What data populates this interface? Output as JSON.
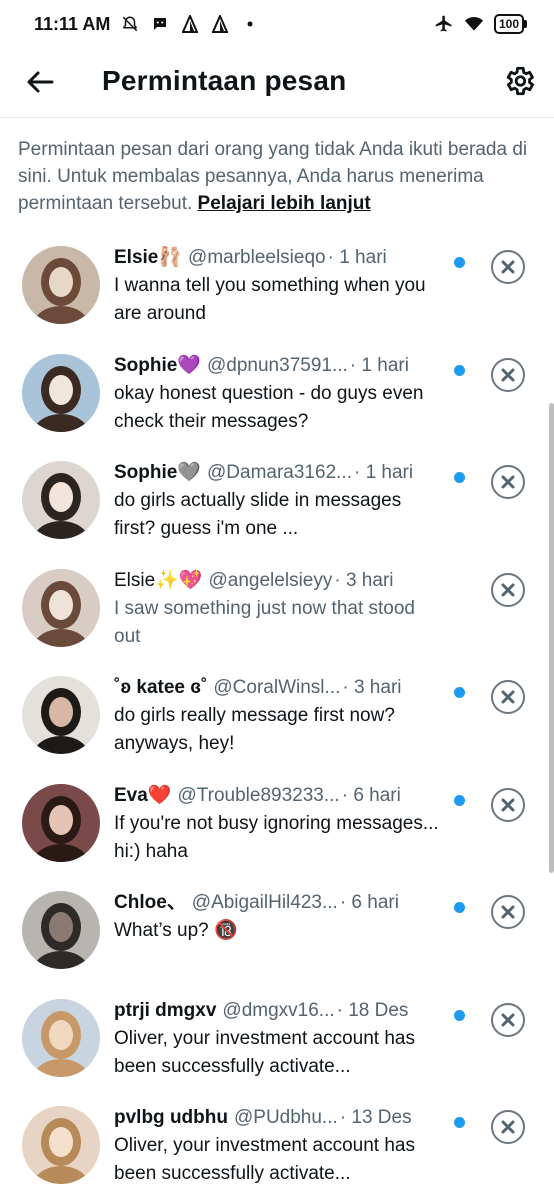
{
  "status_bar": {
    "time": "11:11 AM",
    "battery": "100",
    "icons_left": [
      "notifications-off-icon",
      "chat-bubble-icon",
      "signal-triangle-icon",
      "signal-triangle-icon",
      "dot-icon"
    ],
    "icons_right": [
      "airplane-icon",
      "wifi-icon",
      "battery-icon"
    ]
  },
  "header": {
    "title": "Permintaan pesan",
    "back_icon": "arrow-left-icon",
    "settings_icon": "gear-icon"
  },
  "info": {
    "text": "Permintaan pesan dari orang yang tidak Anda ikuti berada di sini. Untuk membalas pesannya, Anda harus menerima permintaan tersebut. ",
    "link": "Pelajari lebih lanjut"
  },
  "colors": {
    "accent_blue": "#1d9bf0",
    "text_primary": "#0f1419",
    "text_secondary": "#536471"
  },
  "requests": [
    {
      "name": "Elsie🩰",
      "handle": "@marbleelsieqo",
      "time": "· 1 hari",
      "message": "I wanna tell you something when you are around",
      "unread": true
    },
    {
      "name": "Sophie💜",
      "handle": "@dpnun37591...",
      "time": "· 1 hari",
      "message": "okay honest question - do guys even check their messages?",
      "unread": true
    },
    {
      "name": "Sophie🩶",
      "handle": "@Damara3162...",
      "time": "· 1 hari",
      "message": "do girls actually slide in messages first? guess i'm one ...",
      "unread": true
    },
    {
      "name": "Elsie✨💖",
      "handle": "@angelelsieyy",
      "time": "· 3 hari",
      "message": "I saw something just now that stood out",
      "unread": false
    },
    {
      "name": "˚ʚ katee ɞ˚",
      "handle": "@CoralWinsl...",
      "time": "· 3 hari",
      "message": "do girls really message first now? anyways, hey!",
      "unread": true
    },
    {
      "name": "Eva❤️",
      "handle": "@Trouble893233...",
      "time": "· 6 hari",
      "message": "If you're not busy ignoring messages... hi:) haha",
      "unread": true
    },
    {
      "name": "Chloe、",
      "handle": "@AbigailHil423...",
      "time": "· 6 hari",
      "message": "What’s up? 🔞",
      "unread": true
    },
    {
      "name": "ptrji dmgxv",
      "handle": "@dmgxv16...",
      "time": "· 18 Des",
      "message": "Oliver, your investment account has been successfully activate...",
      "unread": true
    },
    {
      "name": "pvlbg udbhu",
      "handle": "@PUdbhu...",
      "time": "· 13 Des",
      "message": "Oliver, your investment account has been successfully activate...",
      "unread": true
    }
  ]
}
